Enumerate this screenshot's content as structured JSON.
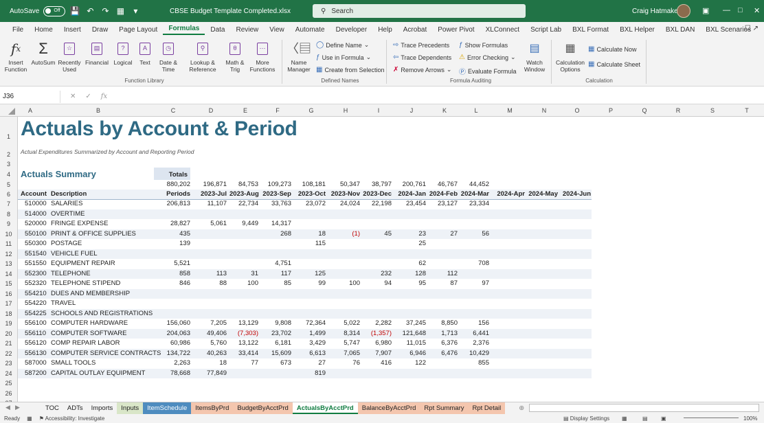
{
  "titlebar": {
    "autosave_label": "AutoSave",
    "autosave_state": "Off",
    "filename": "CBSE Budget Template Completed.xlsx",
    "search_placeholder": "Search",
    "user_name": "Craig Hatmaker",
    "accent_color": "#217346"
  },
  "menu": {
    "tabs": [
      "File",
      "Home",
      "Insert",
      "Draw",
      "Page Layout",
      "Formulas",
      "Data",
      "Review",
      "View",
      "Automate",
      "Developer",
      "Help",
      "Acrobat",
      "Power Pivot",
      "XLConnect",
      "Script Lab",
      "BXL Format",
      "BXL Helper",
      "BXL DAN",
      "BXL Scenarios"
    ],
    "active": "Formulas"
  },
  "ribbon": {
    "function_library": {
      "insert_function": "Insert Function",
      "autosum": "AutoSum",
      "recently_used": "Recently Used",
      "financial": "Financial",
      "logical": "Logical",
      "text": "Text",
      "date_time": "Date & Time",
      "lookup_reference": "Lookup & Reference",
      "math_trig": "Math & Trig",
      "more_functions": "More Functions",
      "group_label": "Function Library"
    },
    "defined_names": {
      "name_manager": "Name Manager",
      "define_name": "Define Name",
      "use_in_formula": "Use in Formula",
      "create_from_selection": "Create from Selection",
      "group_label": "Defined Names"
    },
    "formula_auditing": {
      "trace_precedents": "Trace Precedents",
      "trace_dependents": "Trace Dependents",
      "remove_arrows": "Remove Arrows",
      "show_formulas": "Show Formulas",
      "error_checking": "Error Checking",
      "evaluate_formula": "Evaluate Formula",
      "watch_window": "Watch Window",
      "group_label": "Formula Auditing"
    },
    "calculation": {
      "calculation_options": "Calculation Options",
      "calculate_now": "Calculate Now",
      "calculate_sheet": "Calculate Sheet",
      "group_label": "Calculation"
    }
  },
  "formula_bar": {
    "name_box": "J36",
    "fx_label": "fx",
    "formula": ""
  },
  "columns": [
    "A",
    "B",
    "C",
    "D",
    "E",
    "F",
    "G",
    "H",
    "I",
    "J",
    "K",
    "L",
    "M",
    "N",
    "O",
    "P",
    "Q",
    "R",
    "S",
    "T"
  ],
  "sheet": {
    "title": "Actuals by Account & Period",
    "subtitle": "Actual Expenditures Summarized by Account and Reporting Period",
    "section_title": "Actuals Summary",
    "totals_label": "Totals",
    "period_totals": [
      "880,202",
      "196,871",
      "84,753",
      "109,273",
      "108,181",
      "50,347",
      "38,797",
      "200,761",
      "46,767",
      "44,452",
      "",
      "",
      ""
    ],
    "header": {
      "account": "Account",
      "description": "Description",
      "periods": "Periods",
      "months": [
        "2023-Jul",
        "2023-Aug",
        "2023-Sep",
        "2023-Oct",
        "2023-Nov",
        "2023-Dec",
        "2024-Jan",
        "2024-Feb",
        "2024-Mar",
        "2024-Apr",
        "2024-May",
        "2024-Jun"
      ]
    },
    "rows": [
      {
        "r": "7",
        "acct": "510000",
        "desc": "SALARIES",
        "total": "206,813",
        "vals": [
          "11,107",
          "22,734",
          "33,763",
          "23,072",
          "24,024",
          "22,198",
          "23,454",
          "23,127",
          "23,334",
          "",
          "",
          ""
        ]
      },
      {
        "r": "8",
        "acct": "514000",
        "desc": "OVERTIME",
        "total": "",
        "vals": [
          "",
          "",
          "",
          "",
          "",
          "",
          "",
          "",
          "",
          "",
          "",
          ""
        ]
      },
      {
        "r": "9",
        "acct": "520000",
        "desc": "FRINGE EXPENSE",
        "total": "28,827",
        "vals": [
          "5,061",
          "9,449",
          "14,317",
          "",
          "",
          "",
          "",
          "",
          "",
          "",
          "",
          ""
        ]
      },
      {
        "r": "10",
        "acct": "550100",
        "desc": "PRINT & OFFICE SUPPLIES",
        "total": "435",
        "vals": [
          "",
          "",
          "268",
          "18",
          "(1)",
          "45",
          "23",
          "27",
          "56",
          "",
          "",
          ""
        ]
      },
      {
        "r": "11",
        "acct": "550300",
        "desc": "POSTAGE",
        "total": "139",
        "vals": [
          "",
          "",
          "",
          "115",
          "",
          "",
          "25",
          "",
          "",
          "",
          "",
          ""
        ]
      },
      {
        "r": "12",
        "acct": "551540",
        "desc": "VEHICLE FUEL",
        "total": "",
        "vals": [
          "",
          "",
          "",
          "",
          "",
          "",
          "",
          "",
          "",
          "",
          "",
          ""
        ]
      },
      {
        "r": "13",
        "acct": "551550",
        "desc": "EQUIPMENT REPAIR",
        "total": "5,521",
        "vals": [
          "",
          "",
          "4,751",
          "",
          "",
          "",
          "62",
          "",
          "708",
          "",
          "",
          ""
        ]
      },
      {
        "r": "14",
        "acct": "552300",
        "desc": "TELEPHONE",
        "total": "858",
        "vals": [
          "113",
          "31",
          "117",
          "125",
          "",
          "232",
          "128",
          "112",
          "",
          "",
          "",
          ""
        ]
      },
      {
        "r": "15",
        "acct": "552320",
        "desc": "TELEPHONE STIPEND",
        "total": "846",
        "vals": [
          "88",
          "100",
          "85",
          "99",
          "100",
          "94",
          "95",
          "87",
          "97",
          "",
          "",
          ""
        ]
      },
      {
        "r": "16",
        "acct": "554210",
        "desc": "DUES AND MEMBERSHIP",
        "total": "",
        "vals": [
          "",
          "",
          "",
          "",
          "",
          "",
          "",
          "",
          "",
          "",
          "",
          ""
        ]
      },
      {
        "r": "17",
        "acct": "554220",
        "desc": "TRAVEL",
        "total": "",
        "vals": [
          "",
          "",
          "",
          "",
          "",
          "",
          "",
          "",
          "",
          "",
          "",
          ""
        ]
      },
      {
        "r": "18",
        "acct": "554225",
        "desc": "SCHOOLS AND REGISTRATIONS",
        "total": "",
        "vals": [
          "",
          "",
          "",
          "",
          "",
          "",
          "",
          "",
          "",
          "",
          "",
          ""
        ]
      },
      {
        "r": "19",
        "acct": "556100",
        "desc": "COMPUTER HARDWARE",
        "total": "156,060",
        "vals": [
          "7,205",
          "13,129",
          "9,808",
          "72,364",
          "5,022",
          "2,282",
          "37,245",
          "8,850",
          "156",
          "",
          "",
          ""
        ]
      },
      {
        "r": "20",
        "acct": "556110",
        "desc": "COMPUTER SOFTWARE",
        "total": "204,063",
        "vals": [
          "49,406",
          "(7,303)",
          "23,702",
          "1,499",
          "8,314",
          "(1,357)",
          "121,648",
          "1,713",
          "6,441",
          "",
          "",
          ""
        ]
      },
      {
        "r": "21",
        "acct": "556120",
        "desc": "COMP REPAIR LABOR",
        "total": "60,986",
        "vals": [
          "5,760",
          "13,122",
          "6,181",
          "3,429",
          "5,747",
          "6,980",
          "11,015",
          "6,376",
          "2,376",
          "",
          "",
          ""
        ]
      },
      {
        "r": "22",
        "acct": "556130",
        "desc": "COMPUTER SERVICE CONTRACTS",
        "total": "134,722",
        "vals": [
          "40,263",
          "33,414",
          "15,609",
          "6,613",
          "7,065",
          "7,907",
          "6,946",
          "6,476",
          "10,429",
          "",
          "",
          ""
        ]
      },
      {
        "r": "23",
        "acct": "587000",
        "desc": "SMALL TOOLS",
        "total": "2,263",
        "vals": [
          "18",
          "77",
          "673",
          "27",
          "76",
          "416",
          "122",
          "",
          "855",
          "",
          "",
          ""
        ]
      },
      {
        "r": "24",
        "acct": "587200",
        "desc": "CAPITAL OUTLAY EQUIPMENT",
        "total": "78,668",
        "vals": [
          "77,849",
          "",
          "",
          "819",
          "",
          "",
          "",
          "",
          "",
          "",
          "",
          ""
        ]
      }
    ],
    "row_numbers": [
      "1",
      "2",
      "3",
      "4",
      "5",
      "6",
      "7",
      "8",
      "9",
      "10",
      "11",
      "12",
      "13",
      "14",
      "15",
      "16",
      "17",
      "18",
      "19",
      "20",
      "21",
      "22",
      "23",
      "24",
      "25",
      "26",
      "27"
    ]
  },
  "sheet_tabs": [
    {
      "label": "TOC",
      "color": "#f3f3f3"
    },
    {
      "label": "ADTs",
      "color": "#f3f3f3"
    },
    {
      "label": "Imports",
      "color": "#f3f3f3"
    },
    {
      "label": "Inputs",
      "color": "#d9e6c8"
    },
    {
      "label": "ItemSchedule",
      "color": "#4e8cbf"
    },
    {
      "label": "ItemsByPrd",
      "color": "#f4c6ae"
    },
    {
      "label": "BudgetByAcctPrd",
      "color": "#f4c6ae"
    },
    {
      "label": "ActualsByAcctPrd",
      "color": "#ffffff"
    },
    {
      "label": "BalanceByAcctPrd",
      "color": "#f4c6ae"
    },
    {
      "label": "Rpt Summary",
      "color": "#f4c6ae"
    },
    {
      "label": "Rpt Detail",
      "color": "#f4c6ae"
    }
  ],
  "active_sheet": "ActualsByAcctPrd",
  "status": {
    "ready": "Ready",
    "accessibility": "Accessibility: Investigate",
    "display_settings": "Display Settings",
    "zoom": "100%"
  }
}
